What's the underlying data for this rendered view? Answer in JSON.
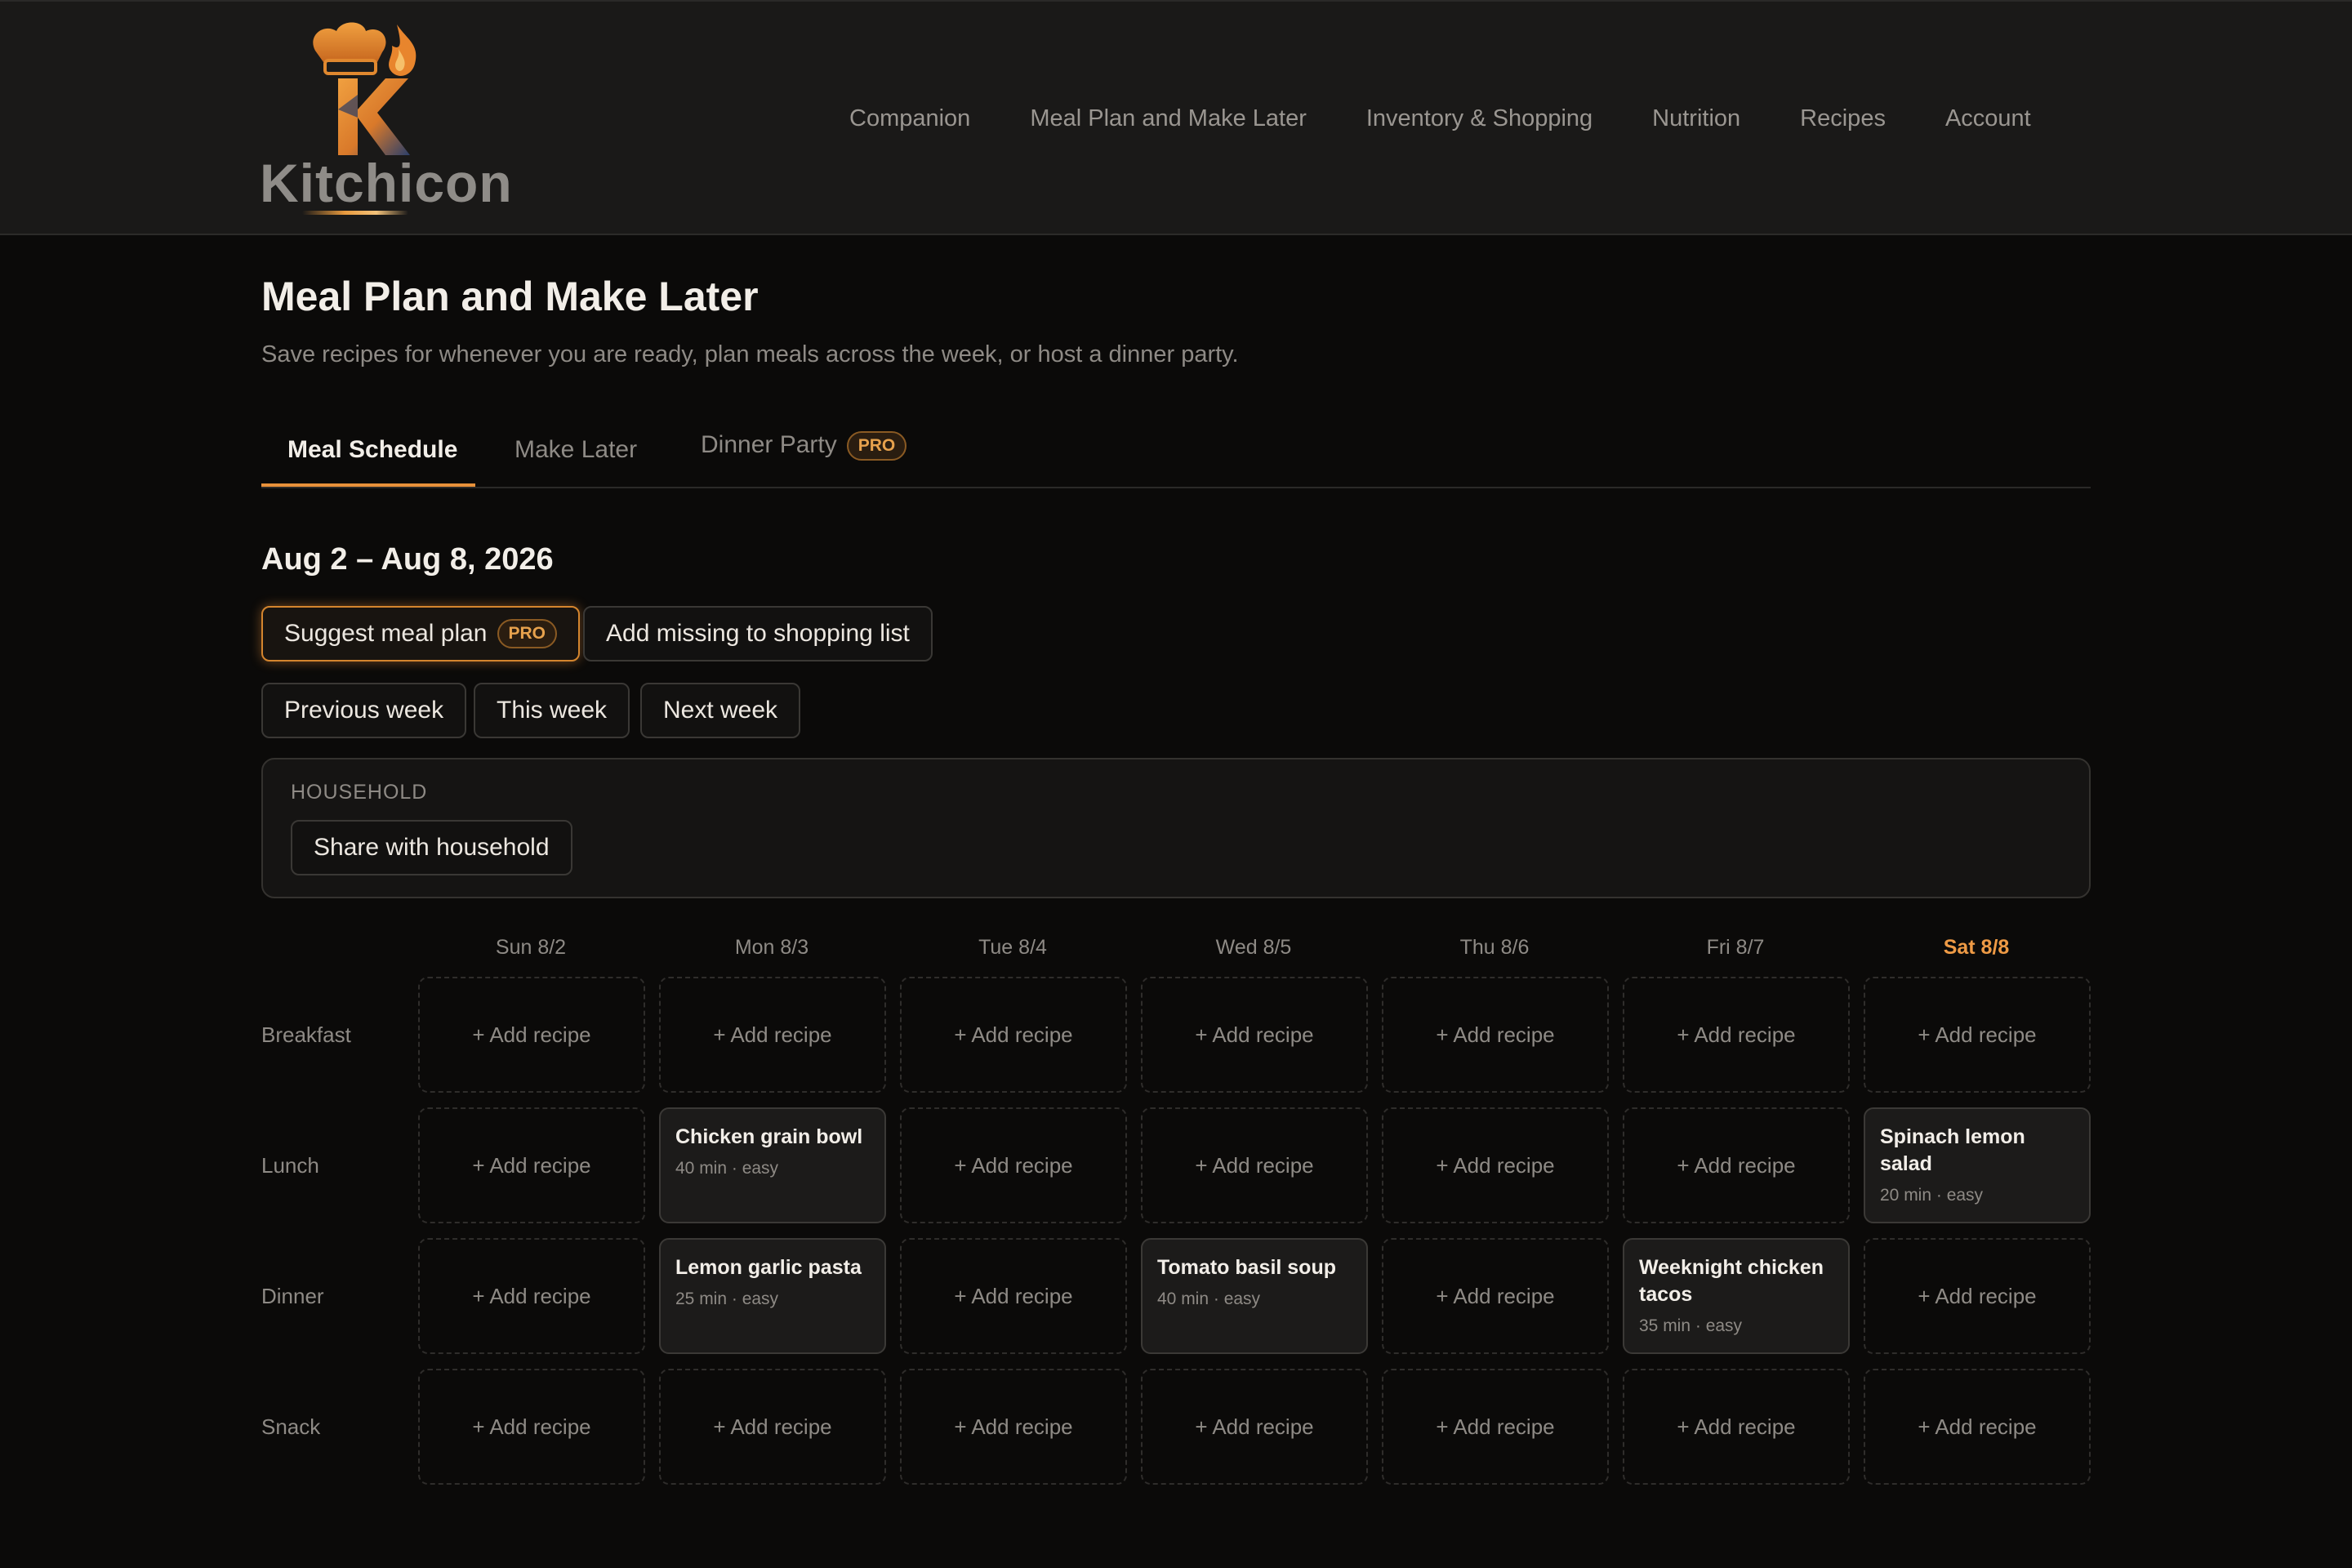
{
  "brand": {
    "name": "Kitchicon",
    "accent": "#e8913a"
  },
  "nav": [
    "Companion",
    "Meal Plan and Make Later",
    "Inventory & Shopping",
    "Nutrition",
    "Recipes",
    "Account"
  ],
  "page": {
    "title": "Meal Plan and Make Later",
    "subtitle": "Save recipes for whenever you are ready, plan meals across the week, or host a dinner party."
  },
  "tabs": [
    {
      "label": "Meal Schedule",
      "active": true
    },
    {
      "label": "Make Later",
      "active": false
    },
    {
      "label": "Dinner Party",
      "active": false,
      "badge": "PRO"
    }
  ],
  "week": {
    "range": "Aug 2 – Aug 8, 2026",
    "suggest_label": "Suggest meal plan",
    "suggest_badge": "PRO",
    "add_missing_label": "Add missing to shopping list",
    "prev_label": "Previous week",
    "this_label": "This week",
    "next_label": "Next week"
  },
  "household": {
    "label": "HOUSEHOLD",
    "share_label": "Share with household"
  },
  "schedule": {
    "empty_label": "+ Add recipe",
    "days": [
      {
        "label": "Sun 8/2",
        "today": false
      },
      {
        "label": "Mon 8/3",
        "today": false
      },
      {
        "label": "Tue 8/4",
        "today": false
      },
      {
        "label": "Wed 8/5",
        "today": false
      },
      {
        "label": "Thu 8/6",
        "today": false
      },
      {
        "label": "Fri 8/7",
        "today": false
      },
      {
        "label": "Sat 8/8",
        "today": true
      }
    ],
    "meals": [
      {
        "label": "Breakfast",
        "cells": [
          null,
          null,
          null,
          null,
          null,
          null,
          null
        ]
      },
      {
        "label": "Lunch",
        "cells": [
          null,
          {
            "name": "Chicken grain bowl",
            "meta": "40 min · easy"
          },
          null,
          null,
          null,
          null,
          {
            "name": "Spinach lemon salad",
            "meta": "20 min · easy"
          }
        ]
      },
      {
        "label": "Dinner",
        "cells": [
          null,
          {
            "name": "Lemon garlic pasta",
            "meta": "25 min · easy"
          },
          null,
          {
            "name": "Tomato basil soup",
            "meta": "40 min · easy"
          },
          null,
          {
            "name": "Weeknight chicken tacos",
            "meta": "35 min · easy"
          },
          null
        ]
      },
      {
        "label": "Snack",
        "cells": [
          null,
          null,
          null,
          null,
          null,
          null,
          null
        ]
      }
    ]
  }
}
